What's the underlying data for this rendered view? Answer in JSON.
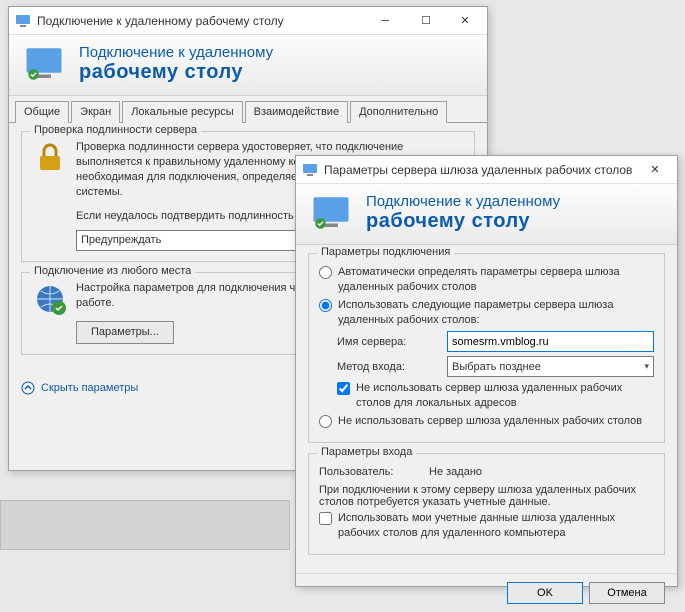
{
  "win1": {
    "title": "Подключение к удаленному рабочему столу",
    "banner": {
      "line1": "Подключение к удаленному",
      "line2": "рабочему столу"
    },
    "tabs": [
      "Общие",
      "Экран",
      "Локальные ресурсы",
      "Взаимодействие",
      "Дополнительно"
    ],
    "activeTab": 4,
    "serverAuth": {
      "legend": "Проверка подлинности сервера",
      "text1": "Проверка подлинности сервера удостоверяет, что подключение выполняется к правильному удаленному компьютеру. Строгость проверки, необходимая для подключения, определяется политикой безопасности системы.",
      "text2": "Если неудалось подтвердить подлинность удаленного компьютера:",
      "combo": "Предупреждать"
    },
    "anywhere": {
      "legend": "Подключение из любого места",
      "text": "Настройка параметров для подключения через шлюз при удаленной работе.",
      "button": "Параметры..."
    },
    "footer": {
      "link": "Скрыть параметры"
    }
  },
  "win2": {
    "title": "Параметры сервера шлюза удаленных рабочих столов",
    "banner": {
      "line1": "Подключение к удаленному",
      "line2": "рабочему столу"
    },
    "connParams": {
      "legend": "Параметры подключения",
      "optAuto": "Автоматически определять параметры сервера шлюза удаленных рабочих столов",
      "optUse": "Использовать следующие параметры сервера шлюза удаленных рабочих столов:",
      "serverLabel": "Имя сервера:",
      "serverValue": "somesrm.vmblog.ru",
      "methodLabel": "Метод входа:",
      "methodValue": "Выбрать позднее",
      "bypassLocal": "Не использовать сервер шлюза удаленных рабочих столов для локальных адресов",
      "optNone": "Не использовать сервер шлюза удаленных рабочих столов"
    },
    "loginParams": {
      "legend": "Параметры входа",
      "userLabel": "Пользователь:",
      "userValue": "Не задано",
      "note": "При подключении к этому серверу шлюза удаленных рабочих столов потребуется указать учетные данные.",
      "shareCreds": "Использовать мои учетные данные шлюза удаленных рабочих столов для удаленного компьютера"
    },
    "buttons": {
      "ok": "OK",
      "cancel": "Отмена"
    }
  }
}
